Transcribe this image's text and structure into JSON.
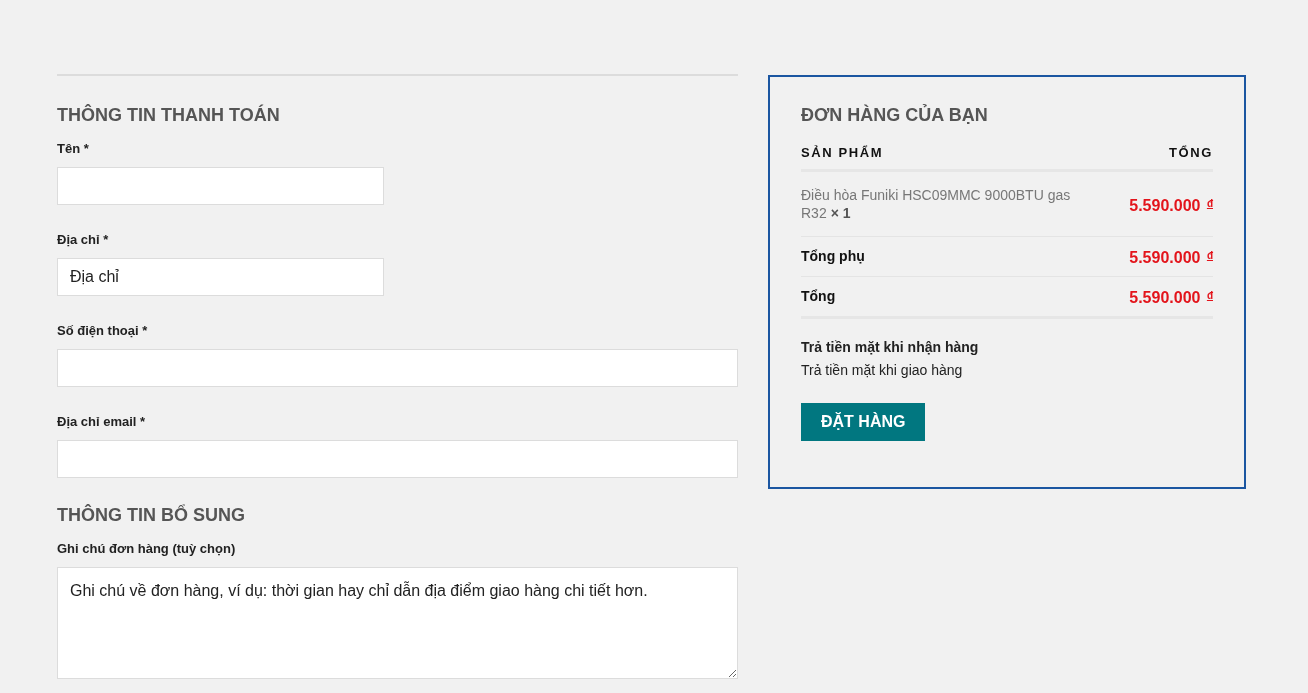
{
  "billing": {
    "title": "THÔNG TIN THANH TOÁN",
    "fields": [
      {
        "label": "Tên *",
        "kind": "half"
      },
      {
        "label": "Địa chỉ *",
        "kind": "half",
        "placeholder": "Địa chỉ"
      },
      {
        "label": "Số điện thoại *",
        "kind": "full"
      },
      {
        "label": "Địa chỉ email *",
        "kind": "full"
      }
    ]
  },
  "additional": {
    "title": "THÔNG TIN BỔ SUNG",
    "fields": [
      {
        "label": "Ghi chú đơn hàng (tuỳ chọn)",
        "kind": "textarea",
        "placeholder": "Ghi chú về đơn hàng, ví dụ: thời gian hay chỉ dẫn địa điểm giao hàng chi tiết hơn."
      }
    ]
  },
  "order": {
    "title": "ĐƠN HÀNG CỦA BẠN",
    "columns": [
      "SẢN PHẨM",
      "TỔNG"
    ],
    "items": [
      {
        "name": "Điều hòa Funiki HSC09MMC 9000BTU gas R32",
        "quantity": "× 1",
        "total": "5.590.000 $^{đ}$"
      }
    ],
    "totals": [
      {
        "label": "Tổng phụ",
        "value": "5.590.000 $^{đ}$"
      },
      {
        "label": "Tổng",
        "value": "5.590.000 $^{đ}$"
      }
    ],
    "payment": {
      "method": "Trả tiền mặt khi nhận hàng",
      "description": "Trả tiền mặt khi giao hàng"
    },
    "button": "ĐẶT HÀNG"
  }
}
